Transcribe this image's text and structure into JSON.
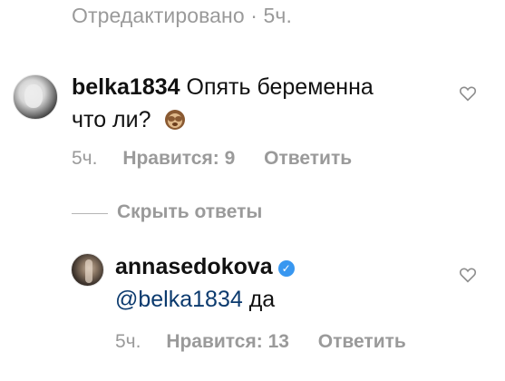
{
  "top": {
    "edited_text": "Отредактировано · 5ч."
  },
  "comments": [
    {
      "username": "belka1834",
      "text_line1": "Опять беременна",
      "text_line2": "что ли?",
      "emoji": "see-no-evil-monkey",
      "time": "5ч.",
      "likes_label": "Нравится: 9",
      "reply_label": "Ответить"
    },
    {
      "username": "annasedokova",
      "verified": true,
      "mention": "@belka1834",
      "text": "да",
      "time": "5ч.",
      "likes_label": "Нравится: 13",
      "reply_label": "Ответить"
    }
  ],
  "hide_replies_label": "Скрыть ответы",
  "colors": {
    "meta_gray": "#9a9a9a",
    "mention_blue": "#0b3a6e",
    "verified_blue": "#3897f0"
  },
  "icons": {
    "like": "heart-outline-icon",
    "verified": "verified-badge-icon"
  }
}
